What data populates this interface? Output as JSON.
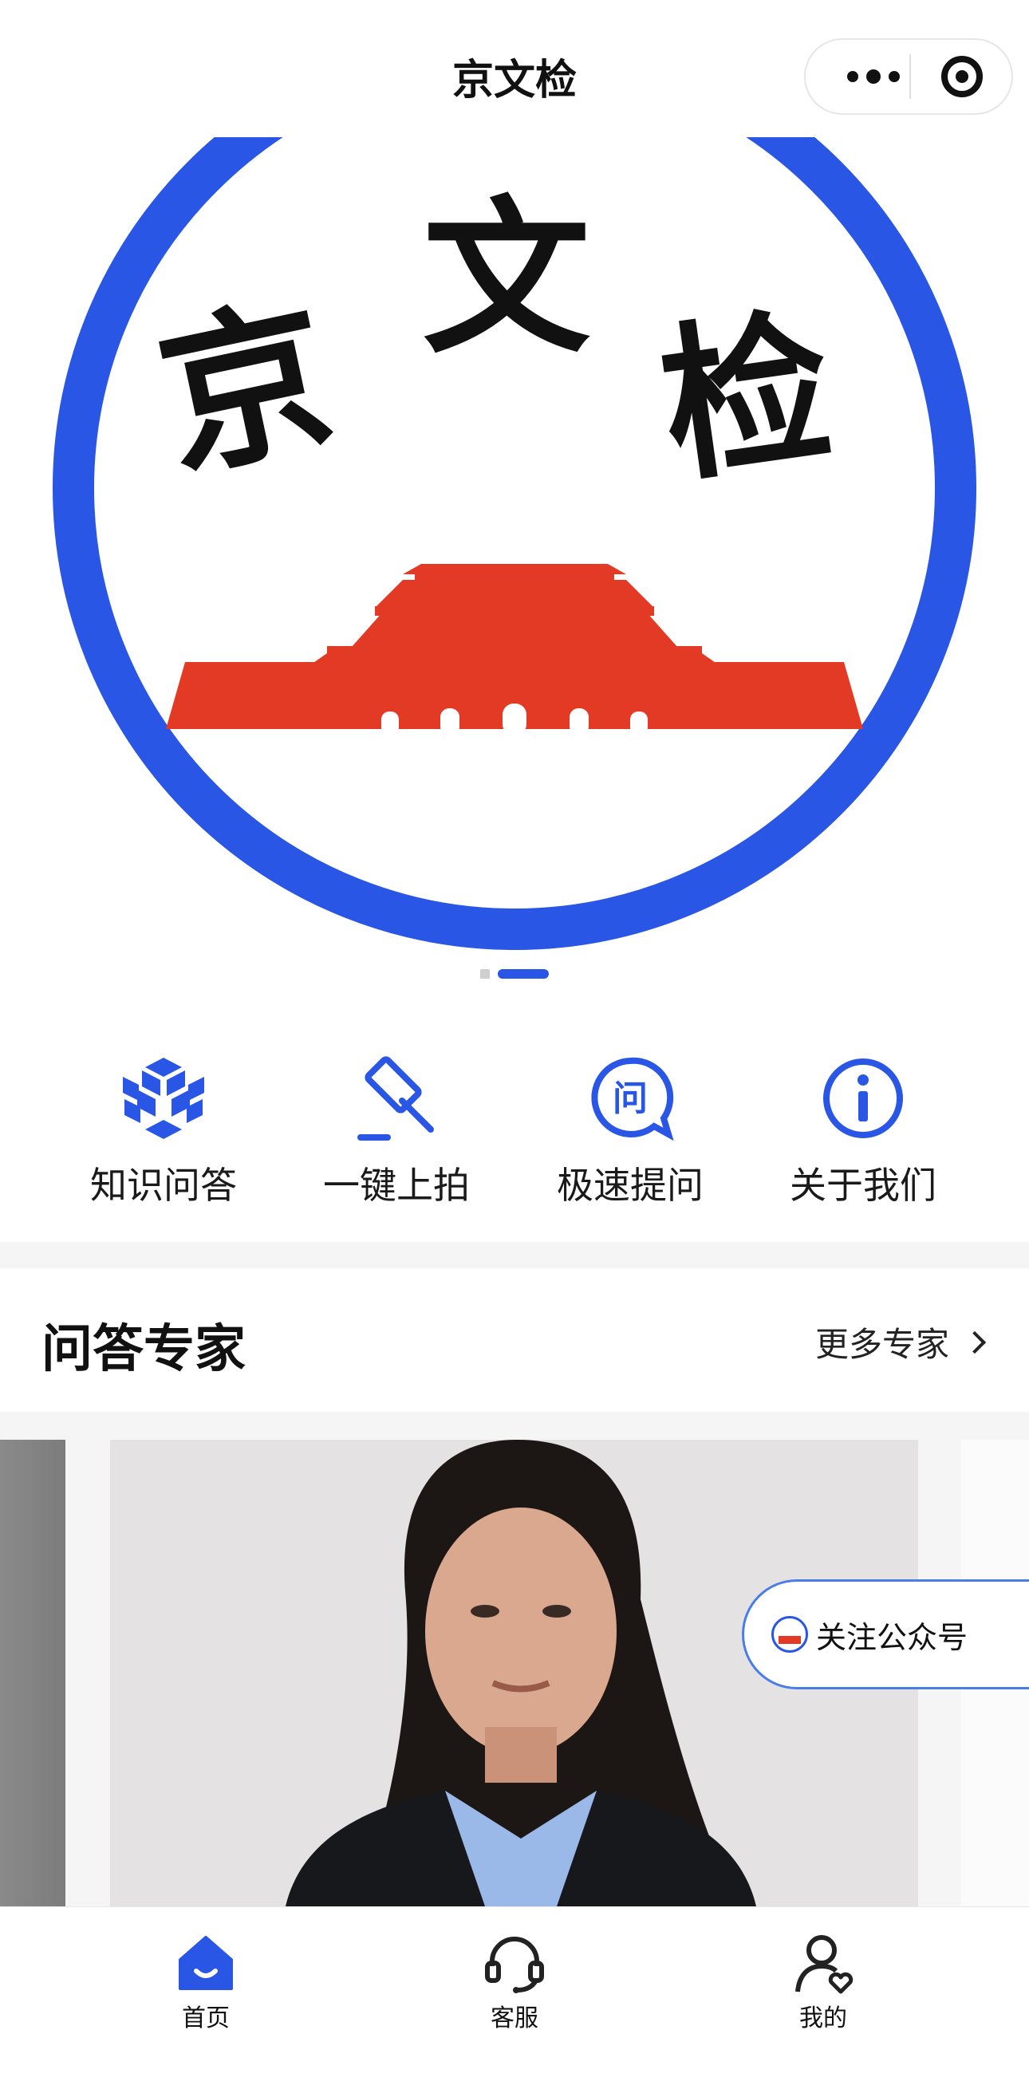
{
  "header": {
    "title": "京文检"
  },
  "banner": {
    "logo_text": "京文检",
    "colors": {
      "ring": "#2a56e6",
      "building": "#e33a25"
    },
    "pager": {
      "count": 2,
      "active": 2
    }
  },
  "quick_nav": [
    {
      "label": "知识问答",
      "icon": "cube-icon"
    },
    {
      "label": "一键上拍",
      "icon": "gavel-icon"
    },
    {
      "label": "极速提问",
      "icon": "question-bubble-icon",
      "glyph": "问"
    },
    {
      "label": "关于我们",
      "icon": "info-icon"
    }
  ],
  "experts": {
    "title": "问答专家",
    "more_label": "更多专家"
  },
  "follow": {
    "label": "关注公众号"
  },
  "tabbar": [
    {
      "label": "首页",
      "icon": "home-icon",
      "active": true
    },
    {
      "label": "客服",
      "icon": "headset-icon",
      "active": false
    },
    {
      "label": "我的",
      "icon": "user-heart-icon",
      "active": false
    }
  ],
  "accent_color": "#2a56e6"
}
